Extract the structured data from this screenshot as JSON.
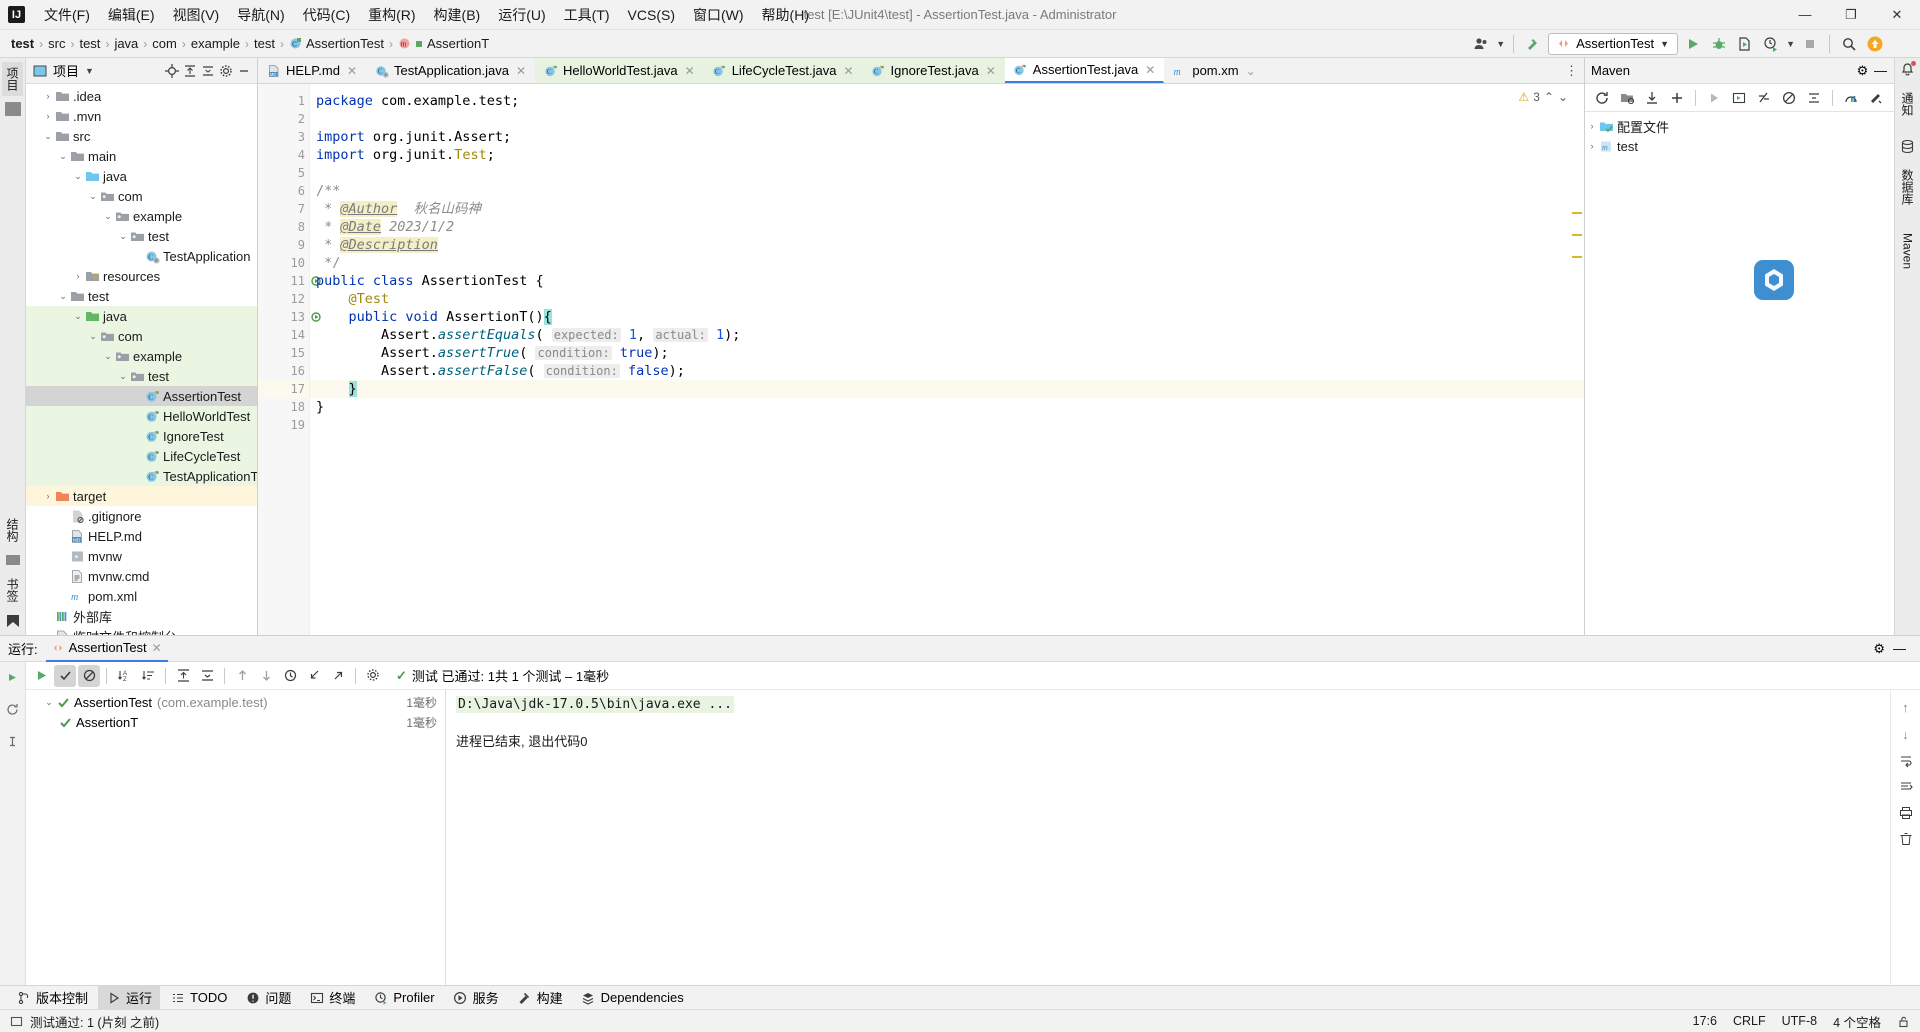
{
  "titlebar": {
    "logo": "IJ",
    "menus": [
      "文件(F)",
      "编辑(E)",
      "视图(V)",
      "导航(N)",
      "代码(C)",
      "重构(R)",
      "构建(B)",
      "运行(U)",
      "工具(T)",
      "VCS(S)",
      "窗口(W)",
      "帮助(H)"
    ],
    "title": "test [E:\\JUnit4\\test] - AssertionTest.java - Administrator",
    "minimize": "—",
    "maximize": "❐",
    "close": "✕"
  },
  "navbar": {
    "crumbs": [
      "test",
      "src",
      "test",
      "java",
      "com",
      "example",
      "test",
      "AssertionTest",
      "AssertionT"
    ],
    "separator": "›",
    "run_config": "AssertionTest",
    "dropdown_caret": "▼"
  },
  "left_strip": {
    "project_label": "项目",
    "commit_label": "提交",
    "structure_label": "结构",
    "bookmarks_label": "书签"
  },
  "project_panel": {
    "title": "项目",
    "caret": "▾",
    "tree": [
      {
        "label": ".idea",
        "depth": 1,
        "arrow": "›",
        "icon": "folder",
        "state": "none"
      },
      {
        "label": ".mvn",
        "depth": 1,
        "arrow": "›",
        "icon": "folder",
        "state": "none"
      },
      {
        "label": "src",
        "depth": 1,
        "arrow": "⌄",
        "icon": "folder",
        "state": "none"
      },
      {
        "label": "main",
        "depth": 2,
        "arrow": "⌄",
        "icon": "folder",
        "state": "none"
      },
      {
        "label": "java",
        "depth": 3,
        "arrow": "⌄",
        "icon": "folder-src",
        "state": "none"
      },
      {
        "label": "com",
        "depth": 4,
        "arrow": "⌄",
        "icon": "package",
        "state": "none"
      },
      {
        "label": "example",
        "depth": 5,
        "arrow": "⌄",
        "icon": "package",
        "state": "none"
      },
      {
        "label": "test",
        "depth": 6,
        "arrow": "⌄",
        "icon": "package",
        "state": "none"
      },
      {
        "label": "TestApplication",
        "depth": 7,
        "arrow": "",
        "icon": "class-run",
        "state": "none"
      },
      {
        "label": "resources",
        "depth": 3,
        "arrow": "›",
        "icon": "folder-res",
        "state": "none"
      },
      {
        "label": "test",
        "depth": 2,
        "arrow": "⌄",
        "icon": "folder",
        "state": "none"
      },
      {
        "label": "java",
        "depth": 3,
        "arrow": "⌄",
        "icon": "folder-test",
        "state": "green"
      },
      {
        "label": "com",
        "depth": 4,
        "arrow": "⌄",
        "icon": "package",
        "state": "green"
      },
      {
        "label": "example",
        "depth": 5,
        "arrow": "⌄",
        "icon": "package",
        "state": "green"
      },
      {
        "label": "test",
        "depth": 6,
        "arrow": "⌄",
        "icon": "package",
        "state": "green"
      },
      {
        "label": "AssertionTest",
        "depth": 7,
        "arrow": "",
        "icon": "class-test",
        "state": "sel"
      },
      {
        "label": "HelloWorldTest",
        "depth": 7,
        "arrow": "",
        "icon": "class-test",
        "state": "green"
      },
      {
        "label": "IgnoreTest",
        "depth": 7,
        "arrow": "",
        "icon": "class-test",
        "state": "green"
      },
      {
        "label": "LifeCycleTest",
        "depth": 7,
        "arrow": "",
        "icon": "class-test",
        "state": "green"
      },
      {
        "label": "TestApplicationT",
        "depth": 7,
        "arrow": "",
        "icon": "class-test",
        "state": "green"
      },
      {
        "label": "target",
        "depth": 1,
        "arrow": "›",
        "icon": "folder-target",
        "state": "yellow"
      },
      {
        "label": ".gitignore",
        "depth": 2,
        "arrow": "",
        "icon": "file-git",
        "state": "none"
      },
      {
        "label": "HELP.md",
        "depth": 2,
        "arrow": "",
        "icon": "file-md",
        "state": "none"
      },
      {
        "label": "mvnw",
        "depth": 2,
        "arrow": "",
        "icon": "file-sh",
        "state": "none"
      },
      {
        "label": "mvnw.cmd",
        "depth": 2,
        "arrow": "",
        "icon": "file-txt",
        "state": "none"
      },
      {
        "label": "pom.xml",
        "depth": 2,
        "arrow": "",
        "icon": "file-maven",
        "state": "none"
      },
      {
        "label": "外部库",
        "depth": 1,
        "arrow": "",
        "icon": "library",
        "state": "none"
      },
      {
        "label": "临时文件和控制台",
        "depth": 1,
        "arrow": "",
        "icon": "scratch",
        "state": "none"
      }
    ]
  },
  "editor": {
    "tabs": [
      {
        "label": "HELP.md",
        "icon": "md",
        "active": false,
        "green": false
      },
      {
        "label": "TestApplication.java",
        "icon": "java",
        "active": false,
        "green": false
      },
      {
        "label": "HelloWorldTest.java",
        "icon": "java-test",
        "active": false,
        "green": true
      },
      {
        "label": "LifeCycleTest.java",
        "icon": "java-test",
        "active": false,
        "green": true
      },
      {
        "label": "IgnoreTest.java",
        "icon": "java-test",
        "active": false,
        "green": true
      },
      {
        "label": "AssertionTest.java",
        "icon": "java-test",
        "active": true,
        "green": false
      },
      {
        "label": "pom.xm",
        "icon": "maven",
        "active": false,
        "green": false
      }
    ],
    "tab_close": "✕",
    "tab_overflow": "⌄",
    "tab_more": "⋮",
    "warning_count": "3",
    "warning_icon": "⚠",
    "inspect_up": "⌃",
    "inspect_down": "⌄",
    "line_numbers": [
      "1",
      "2",
      "3",
      "4",
      "5",
      "6",
      "7",
      "8",
      "9",
      "10",
      "11",
      "12",
      "13",
      "14",
      "15",
      "16",
      "17",
      "18",
      "19"
    ],
    "cursor_line": 17,
    "run_gutter_lines": [
      11,
      13
    ],
    "code_lines": [
      {
        "n": 1,
        "segs": [
          {
            "t": "package ",
            "c": "kw"
          },
          {
            "t": "com.example.test;",
            "c": ""
          }
        ]
      },
      {
        "n": 2,
        "segs": []
      },
      {
        "n": 3,
        "segs": [
          {
            "t": "import ",
            "c": "kw"
          },
          {
            "t": "org.junit.Assert;",
            "c": ""
          }
        ]
      },
      {
        "n": 4,
        "segs": [
          {
            "t": "import ",
            "c": "kw"
          },
          {
            "t": "org.junit.",
            "c": ""
          },
          {
            "t": "Test",
            "c": "anno"
          },
          {
            "t": ";",
            "c": ""
          }
        ]
      },
      {
        "n": 5,
        "segs": []
      },
      {
        "n": 6,
        "segs": [
          {
            "t": "/**",
            "c": "cmt"
          }
        ]
      },
      {
        "n": 7,
        "segs": [
          {
            "t": " * ",
            "c": "cmt"
          },
          {
            "t": "@Author",
            "c": "jdoc-tag"
          },
          {
            "t": "  秋名山码神",
            "c": "jdoc-txt"
          }
        ]
      },
      {
        "n": 8,
        "segs": [
          {
            "t": " * ",
            "c": "cmt"
          },
          {
            "t": "@Date",
            "c": "jdoc-tag"
          },
          {
            "t": " 2023/1/2",
            "c": "jdoc-txt"
          }
        ]
      },
      {
        "n": 9,
        "segs": [
          {
            "t": " * ",
            "c": "cmt"
          },
          {
            "t": "@Description",
            "c": "jdoc-tag"
          }
        ]
      },
      {
        "n": 10,
        "segs": [
          {
            "t": " */",
            "c": "cmt"
          }
        ]
      },
      {
        "n": 11,
        "segs": [
          {
            "t": "public class ",
            "c": "kw"
          },
          {
            "t": "AssertionTest {",
            "c": ""
          }
        ]
      },
      {
        "n": 12,
        "segs": [
          {
            "t": "    ",
            "c": ""
          },
          {
            "t": "@Test",
            "c": "anno"
          }
        ]
      },
      {
        "n": 13,
        "segs": [
          {
            "t": "    ",
            "c": ""
          },
          {
            "t": "public void ",
            "c": "kw"
          },
          {
            "t": "AssertionT",
            "c": "meth-plain"
          },
          {
            "t": "()",
            "c": ""
          },
          {
            "t": "{",
            "c": "caret-hl"
          }
        ]
      },
      {
        "n": 14,
        "segs": [
          {
            "t": "        Assert.",
            "c": ""
          },
          {
            "t": "assertEquals",
            "c": "meth"
          },
          {
            "t": "( ",
            "c": ""
          },
          {
            "t": "expected:",
            "c": "hint"
          },
          {
            "t": " ",
            "c": ""
          },
          {
            "t": "1",
            "c": "num"
          },
          {
            "t": ", ",
            "c": ""
          },
          {
            "t": "actual:",
            "c": "hint"
          },
          {
            "t": " ",
            "c": ""
          },
          {
            "t": "1",
            "c": "num"
          },
          {
            "t": ");",
            "c": ""
          }
        ]
      },
      {
        "n": 15,
        "segs": [
          {
            "t": "        Assert.",
            "c": ""
          },
          {
            "t": "assertTrue",
            "c": "meth"
          },
          {
            "t": "( ",
            "c": ""
          },
          {
            "t": "condition:",
            "c": "hint"
          },
          {
            "t": " ",
            "c": ""
          },
          {
            "t": "true",
            "c": "kw"
          },
          {
            "t": ");",
            "c": ""
          }
        ]
      },
      {
        "n": 16,
        "segs": [
          {
            "t": "        Assert.",
            "c": ""
          },
          {
            "t": "assertFalse",
            "c": "meth"
          },
          {
            "t": "( ",
            "c": ""
          },
          {
            "t": "condition:",
            "c": "hint"
          },
          {
            "t": " ",
            "c": ""
          },
          {
            "t": "false",
            "c": "kw"
          },
          {
            "t": ");",
            "c": ""
          }
        ]
      },
      {
        "n": 17,
        "segs": [
          {
            "t": "    ",
            "c": ""
          },
          {
            "t": "}",
            "c": "caret-hl"
          }
        ]
      },
      {
        "n": 18,
        "segs": [
          {
            "t": "}",
            "c": ""
          }
        ]
      },
      {
        "n": 19,
        "segs": []
      }
    ]
  },
  "maven": {
    "title": "Maven",
    "gear": "⚙",
    "minimize": "—",
    "tree": [
      {
        "label": "配置文件",
        "arrow": "›",
        "icon": "profiles"
      },
      {
        "label": "test",
        "arrow": "›",
        "icon": "maven-project"
      }
    ]
  },
  "right_strip": {
    "notifications_label": "通知",
    "database_label": "数据库",
    "maven_label": "Maven"
  },
  "run_panel": {
    "label": "运行:",
    "tab_name": "AssertionTest",
    "tab_close": "✕",
    "status_text": "测试 已通过: 1共 1 个测试 – 1毫秒",
    "status_check": "✓",
    "settings_icon": "⚙",
    "minimize": "—",
    "tests": [
      {
        "name": "AssertionTest",
        "package": "(com.example.test)",
        "time": "1毫秒",
        "depth": 0,
        "expanded": true
      },
      {
        "name": "AssertionT",
        "package": "",
        "time": "1毫秒",
        "depth": 1,
        "expanded": false
      }
    ],
    "console": {
      "command": "D:\\Java\\jdk-17.0.5\\bin\\java.exe ...",
      "exit": "进程已结束, 退出代码0"
    }
  },
  "toolwindow_bar": {
    "items": [
      {
        "label": "版本控制",
        "icon": "branch",
        "active": false
      },
      {
        "label": "运行",
        "icon": "play",
        "active": true
      },
      {
        "label": "TODO",
        "icon": "list",
        "active": false
      },
      {
        "label": "问题",
        "icon": "warn",
        "active": false
      },
      {
        "label": "终端",
        "icon": "terminal",
        "active": false
      },
      {
        "label": "Profiler",
        "icon": "profiler",
        "active": false
      },
      {
        "label": "服务",
        "icon": "services",
        "active": false
      },
      {
        "label": "构建",
        "icon": "hammer",
        "active": false
      },
      {
        "label": "Dependencies",
        "icon": "deps",
        "active": false
      }
    ]
  },
  "statusbar": {
    "message": "测试通过: 1 (片刻 之前)",
    "caret_position": "17:6",
    "line_separator": "CRLF",
    "encoding": "UTF-8",
    "indent": "4 个空格",
    "lock_icon": "🔓"
  }
}
